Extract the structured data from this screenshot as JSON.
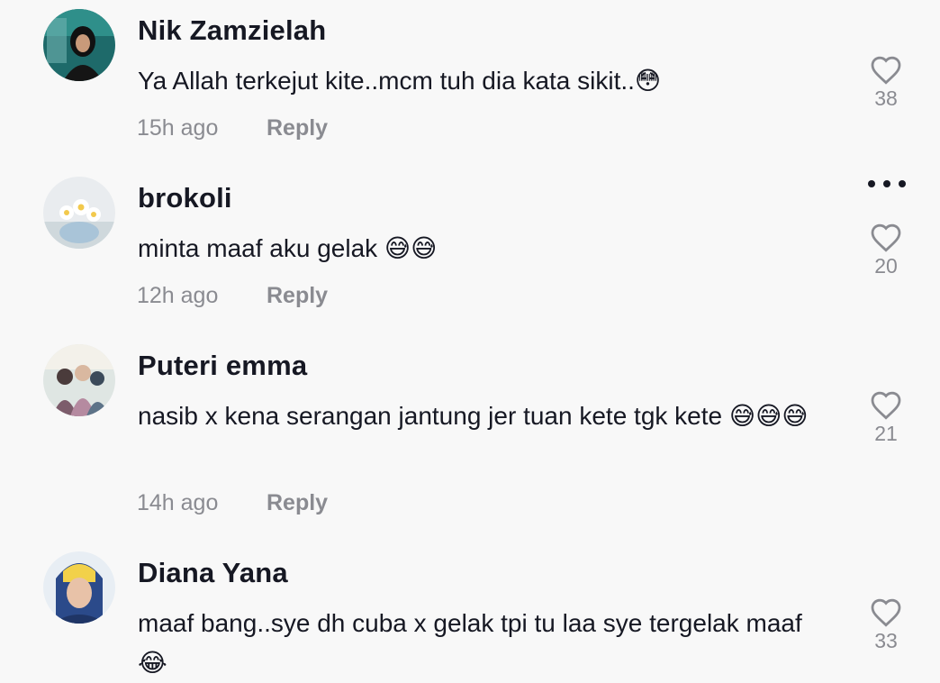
{
  "comments": [
    {
      "username": "Nik Zamzielah",
      "text": "Ya Allah terkejut kite..mcm tuh dia kata sikit..😳",
      "time": "15h ago",
      "reply_label": "Reply",
      "likes": "38"
    },
    {
      "username": "brokoli",
      "text": "minta maaf aku gelak 😅😅",
      "time": "12h ago",
      "reply_label": "Reply",
      "likes": "20"
    },
    {
      "username": "Puteri emma",
      "text": "nasib x kena serangan jantung jer tuan kete tgk kete 😅😅😅",
      "time": "14h ago",
      "reply_label": "Reply",
      "likes": "21"
    },
    {
      "username": "Diana Yana",
      "text": "maaf bang..sye dh cuba x gelak tpi tu laa sye tergelak maaf😂",
      "likes": "33"
    }
  ],
  "icons": {
    "like": "heart-outline-icon",
    "more": "more-horizontal-icon"
  },
  "colors": {
    "background": "#f8f8f8",
    "text": "#161823",
    "muted": "#8a8b91"
  }
}
